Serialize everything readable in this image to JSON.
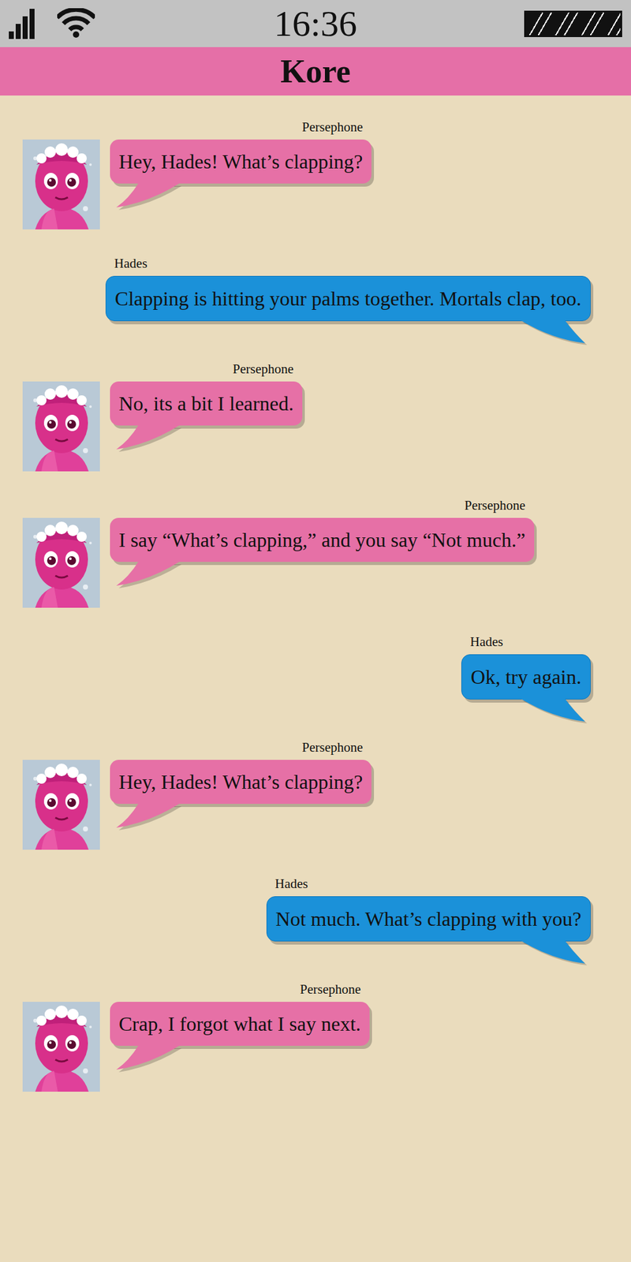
{
  "status_bar": {
    "time": "16:36",
    "signal_level": 1,
    "wifi_level": 1,
    "battery_level": 1
  },
  "header": {
    "title": "Kore"
  },
  "messages": [
    {
      "sender": "Persephone",
      "text": "Hey, Hades! What’s clapping?",
      "kind": "received"
    },
    {
      "sender": "Hades",
      "text": "Clapping is hitting your palms together. Mortals clap, too.",
      "kind": "sent"
    },
    {
      "sender": "Persephone",
      "text": "No, its a bit I learned.",
      "kind": "received"
    },
    {
      "sender": "Persephone",
      "text": "I say “What’s clapping,” and you say “Not much.”",
      "kind": "received"
    },
    {
      "sender": "Hades",
      "text": "Ok, try again.",
      "kind": "sent"
    },
    {
      "sender": "Persephone",
      "text": "Hey, Hades! What’s clapping?",
      "kind": "received"
    },
    {
      "sender": "Hades",
      "text": "Not much. What’s clapping with you?",
      "kind": "sent"
    },
    {
      "sender": "Persephone",
      "text": "Crap, I forgot what I say next.",
      "kind": "received"
    }
  ]
}
